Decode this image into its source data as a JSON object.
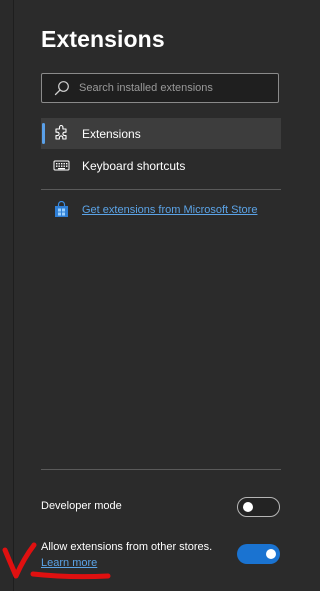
{
  "page": {
    "title": "Extensions"
  },
  "search": {
    "placeholder": "Search installed extensions",
    "icon": "search-icon"
  },
  "nav": {
    "items": [
      {
        "label": "Extensions",
        "icon": "puzzle-icon",
        "active": true
      },
      {
        "label": "Keyboard shortcuts",
        "icon": "keyboard-icon",
        "active": false
      }
    ]
  },
  "store_link": {
    "label": "Get extensions from Microsoft Store",
    "icon": "store-bag-icon"
  },
  "settings": {
    "developer_mode": {
      "label": "Developer mode",
      "enabled": false
    },
    "other_stores": {
      "label": "Allow extensions from other stores.",
      "enabled": true,
      "link": "Learn more"
    }
  },
  "colors": {
    "background": "#2b2b2b",
    "accent": "#1a73d1",
    "link": "#5ba3e6",
    "annotation": "#e01010"
  }
}
